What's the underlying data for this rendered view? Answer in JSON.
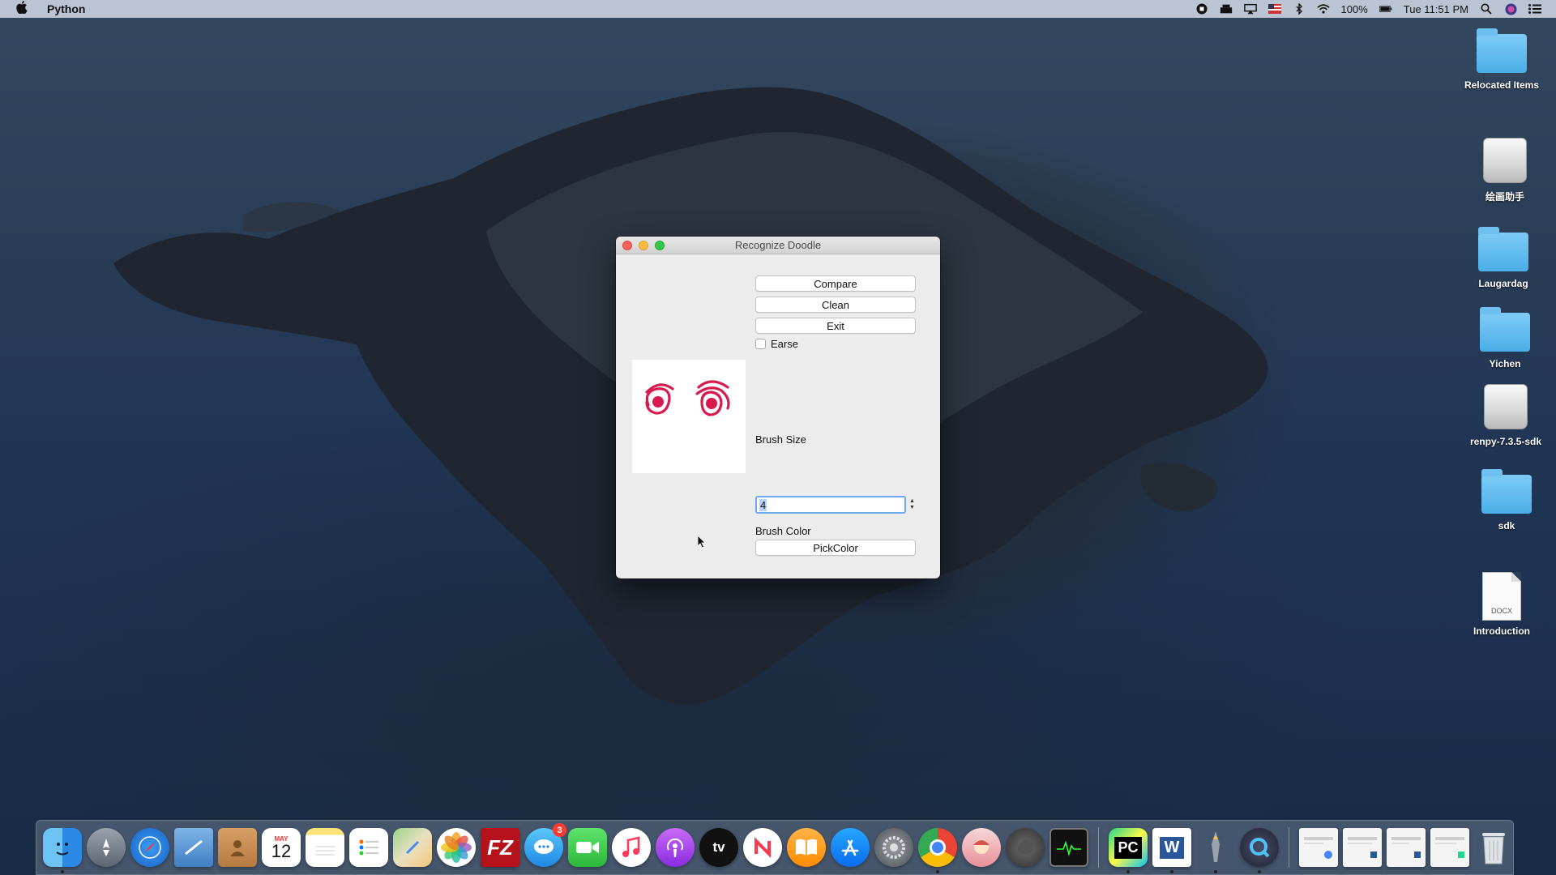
{
  "menubar": {
    "app_name": "Python",
    "battery": "100%",
    "clock": "Tue 11:51 PM"
  },
  "desktop": {
    "items": [
      {
        "label": "Relocated Items",
        "kind": "folder"
      },
      {
        "label": "绘画助手",
        "kind": "drive"
      },
      {
        "label": "Laugardag",
        "kind": "folder"
      },
      {
        "label": "Yichen",
        "kind": "folder"
      },
      {
        "label": "renpy-7.3.5-sdk",
        "kind": "drive"
      },
      {
        "label": "sdk",
        "kind": "folder"
      },
      {
        "label": "Introduction",
        "kind": "docx"
      }
    ],
    "docx_tag": "DOCX"
  },
  "window": {
    "title": "Recognize Doodle",
    "compare_label": "Compare",
    "clean_label": "Clean",
    "exit_label": "Exit",
    "erase_label": "Earse",
    "erase_checked": false,
    "brush_size_label": "Brush Size",
    "brush_size_value": "4",
    "brush_color_label": "Brush Color",
    "pick_color_label": "PickColor",
    "stroke_color": "#d81b4f"
  },
  "dock": {
    "calendar_month": "MAY",
    "calendar_day": "12",
    "messages_badge": "3",
    "tv_label": "tv",
    "pycharm_label": "PC",
    "word_label": "W",
    "filezilla_label": "FZ"
  }
}
